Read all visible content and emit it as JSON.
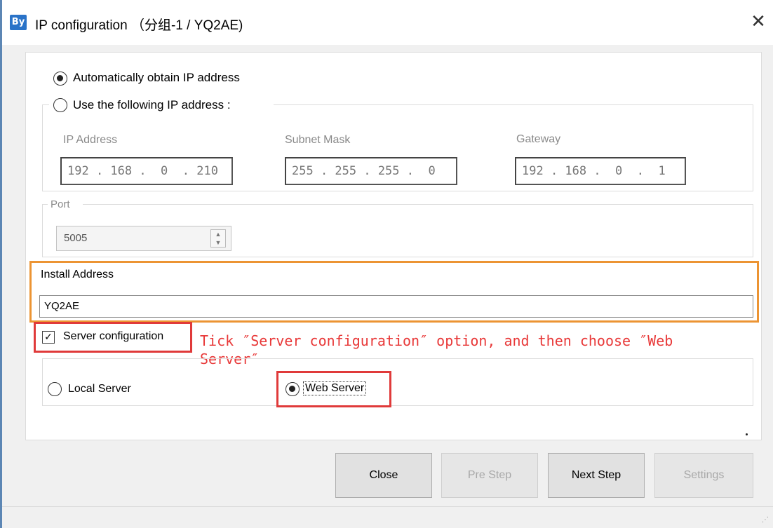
{
  "window": {
    "title": "IP configuration （分组-1 / YQ2AE)",
    "icon_name": "app-logo-icon",
    "close_glyph": "✕"
  },
  "ip_mode": {
    "auto_label": "Automatically obtain IP address",
    "manual_label": "Use the following IP address :",
    "selected": "auto"
  },
  "fields": {
    "ip_label": "IP Address",
    "ip_value": "192 . 168 .  0  . 210",
    "mask_label": "Subnet Mask",
    "mask_value": "255 . 255 . 255 .  0",
    "gateway_label": "Gateway",
    "gateway_value": "192 . 168 .  0  .  1"
  },
  "port": {
    "label": "Port",
    "value": "5005"
  },
  "install_address": {
    "label": "Install Address",
    "value": "YQ2AE"
  },
  "server": {
    "checkbox_label": "Server configuration",
    "checked": true,
    "local_label": "Local Server",
    "web_label": "Web Server",
    "selected": "web"
  },
  "annotation": {
    "line1": "Tick ″Server configuration″ option, and then choose ″Web",
    "line2": "Server″"
  },
  "buttons": {
    "close": "Close",
    "pre_step": "Pre Step",
    "next_step": "Next Step",
    "settings": "Settings"
  },
  "colors": {
    "highlight_orange": "#ec9433",
    "highlight_red": "#e03a3a",
    "annotation_text": "#e83838"
  }
}
